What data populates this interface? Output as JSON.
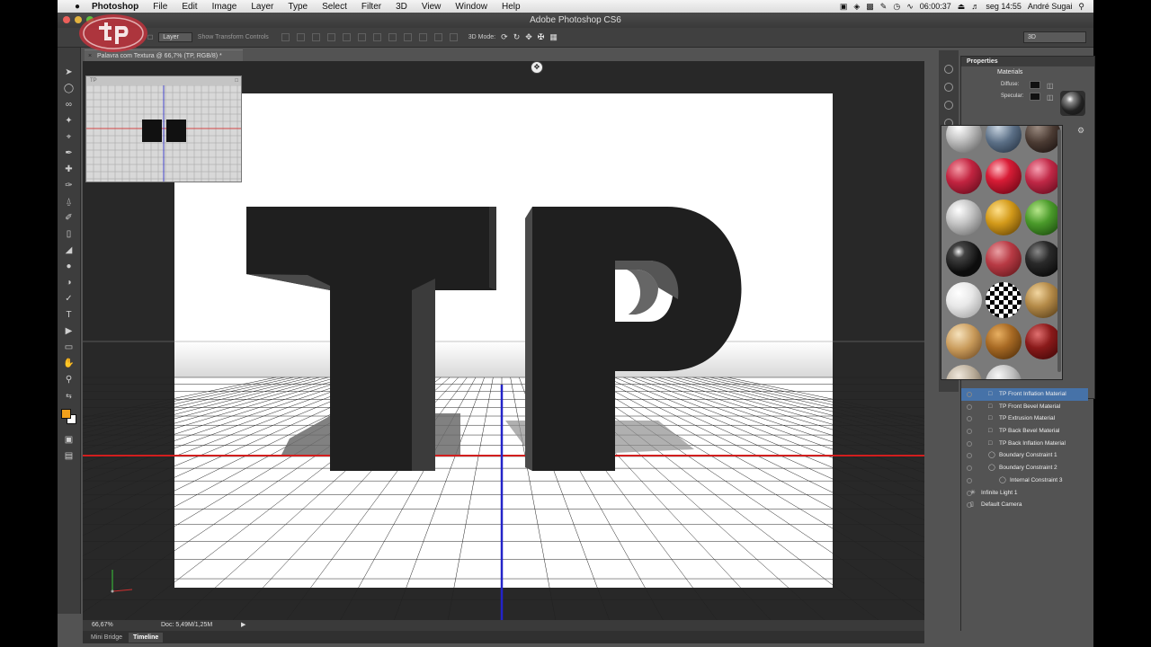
{
  "menubar": {
    "app": "Photoshop",
    "menus": [
      "File",
      "Edit",
      "Image",
      "Layer",
      "Type",
      "Select",
      "Filter",
      "3D",
      "View",
      "Window",
      "Help"
    ],
    "clock": "06:00:37",
    "datetime": "seg 14:55",
    "user": "André Sugai"
  },
  "window": {
    "title": "Adobe Photoshop CS6"
  },
  "options": {
    "layer_select": "Layer",
    "show_transform": "Show Transform Controls",
    "mode_label": "3D Mode:",
    "workspace": "3D"
  },
  "document": {
    "tab_title": "Palavra com Textura @ 66,7% (TP, RGB/8) *",
    "text_3d": "TP"
  },
  "status": {
    "zoom": "66,67%",
    "doc_size": "Doc: 5,49M/1,25M"
  },
  "bottom_tabs": [
    "Mini Bridge",
    "Timeline"
  ],
  "properties": {
    "panel_title": "Properties",
    "section": "Materials",
    "diffuse_label": "Diffuse:",
    "specular_label": "Specular:"
  },
  "materials": [
    {
      "icon": "sphere-metal-light"
    },
    {
      "icon": "sphere-denim-blue"
    },
    {
      "icon": "sphere-dark-bronze"
    },
    {
      "icon": "sphere-red-fabric"
    },
    {
      "icon": "sphere-red-gloss"
    },
    {
      "icon": "sphere-red-fabric-2"
    },
    {
      "icon": "sphere-silver"
    },
    {
      "icon": "sphere-gold"
    },
    {
      "icon": "sphere-green"
    },
    {
      "icon": "sphere-black-gloss"
    },
    {
      "icon": "sphere-red-brick"
    },
    {
      "icon": "sphere-black-matte"
    },
    {
      "icon": "sphere-white-matte"
    },
    {
      "icon": "sphere-checker"
    },
    {
      "icon": "sphere-straw"
    },
    {
      "icon": "sphere-wood-light"
    },
    {
      "icon": "sphere-cork"
    },
    {
      "icon": "sphere-red-dark"
    },
    {
      "icon": "sphere-stone"
    },
    {
      "icon": "sphere-marble"
    }
  ],
  "scene_items": [
    {
      "label": "TP Front Inflation Material",
      "selected": true
    },
    {
      "label": "TP Front Bevel Material"
    },
    {
      "label": "TP Extrusion Material"
    },
    {
      "label": "TP Back Bevel Material"
    },
    {
      "label": "TP Back Inflation Material"
    },
    {
      "label": "Boundary Constraint 1"
    },
    {
      "label": "Boundary Constraint 2"
    },
    {
      "label": "Internal Constraint 3"
    },
    {
      "label": "Infinite Light 1"
    },
    {
      "label": "Default Camera"
    }
  ],
  "colors": {
    "foreground": "#f2a11b",
    "background": "#ffffff",
    "selection": "#4672a8"
  }
}
